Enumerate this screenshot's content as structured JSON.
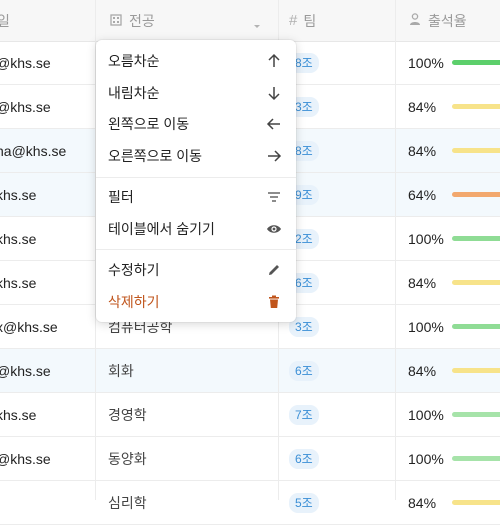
{
  "header": {
    "major_label": "전공",
    "team_label": "팀",
    "attendance_label": "출석율",
    "left_label_fragment": "일"
  },
  "rows": [
    {
      "email": "@khs.se",
      "major": "",
      "team": "8조",
      "attendance": "100%",
      "bar_color": "#5ccf6b",
      "highlight": false
    },
    {
      "email": "@khs.se",
      "major": "",
      "team": "3조",
      "attendance": "84%",
      "bar_color": "#f7e38a",
      "highlight": false
    },
    {
      "email": "na@khs.se",
      "major": "",
      "team": "8조",
      "attendance": "84%",
      "bar_color": "#f7e38a",
      "highlight": true
    },
    {
      "email": "khs.se",
      "major": "",
      "team": "9조",
      "attendance": "64%",
      "bar_color": "#f2a86e",
      "highlight": true
    },
    {
      "email": "khs.se",
      "major": "",
      "team": "2조",
      "attendance": "100%",
      "bar_color": "#8fdc95",
      "highlight": false
    },
    {
      "email": "khs.se",
      "major": "",
      "team": "6조",
      "attendance": "84%",
      "bar_color": "#f7e38a",
      "highlight": false
    },
    {
      "email": "x@khs.se",
      "major": "컴퓨터공학",
      "team": "3조",
      "attendance": "100%",
      "bar_color": "#8fdc95",
      "highlight": false
    },
    {
      "email": "@khs.se",
      "major": "회화",
      "team": "6조",
      "attendance": "84%",
      "bar_color": "#f7e38a",
      "highlight": true
    },
    {
      "email": "khs.se",
      "major": "경영학",
      "team": "7조",
      "attendance": "100%",
      "bar_color": "#a6e3a9",
      "highlight": false
    },
    {
      "email": "@khs.se",
      "major": "동양화",
      "team": "6조",
      "attendance": "100%",
      "bar_color": "#a6e3a9",
      "highlight": false
    },
    {
      "email": "",
      "major": "심리학",
      "team": "5조",
      "attendance": "84%",
      "bar_color": "#f7e38a",
      "highlight": false
    }
  ],
  "menu": {
    "sort_asc": "오름차순",
    "sort_desc": "내림차순",
    "move_left": "왼쪽으로 이동",
    "move_right": "오른쪽으로 이동",
    "filter": "필터",
    "hide": "테이블에서 숨기기",
    "edit": "수정하기",
    "delete": "삭제하기",
    "delete_color": "#c0551c"
  }
}
